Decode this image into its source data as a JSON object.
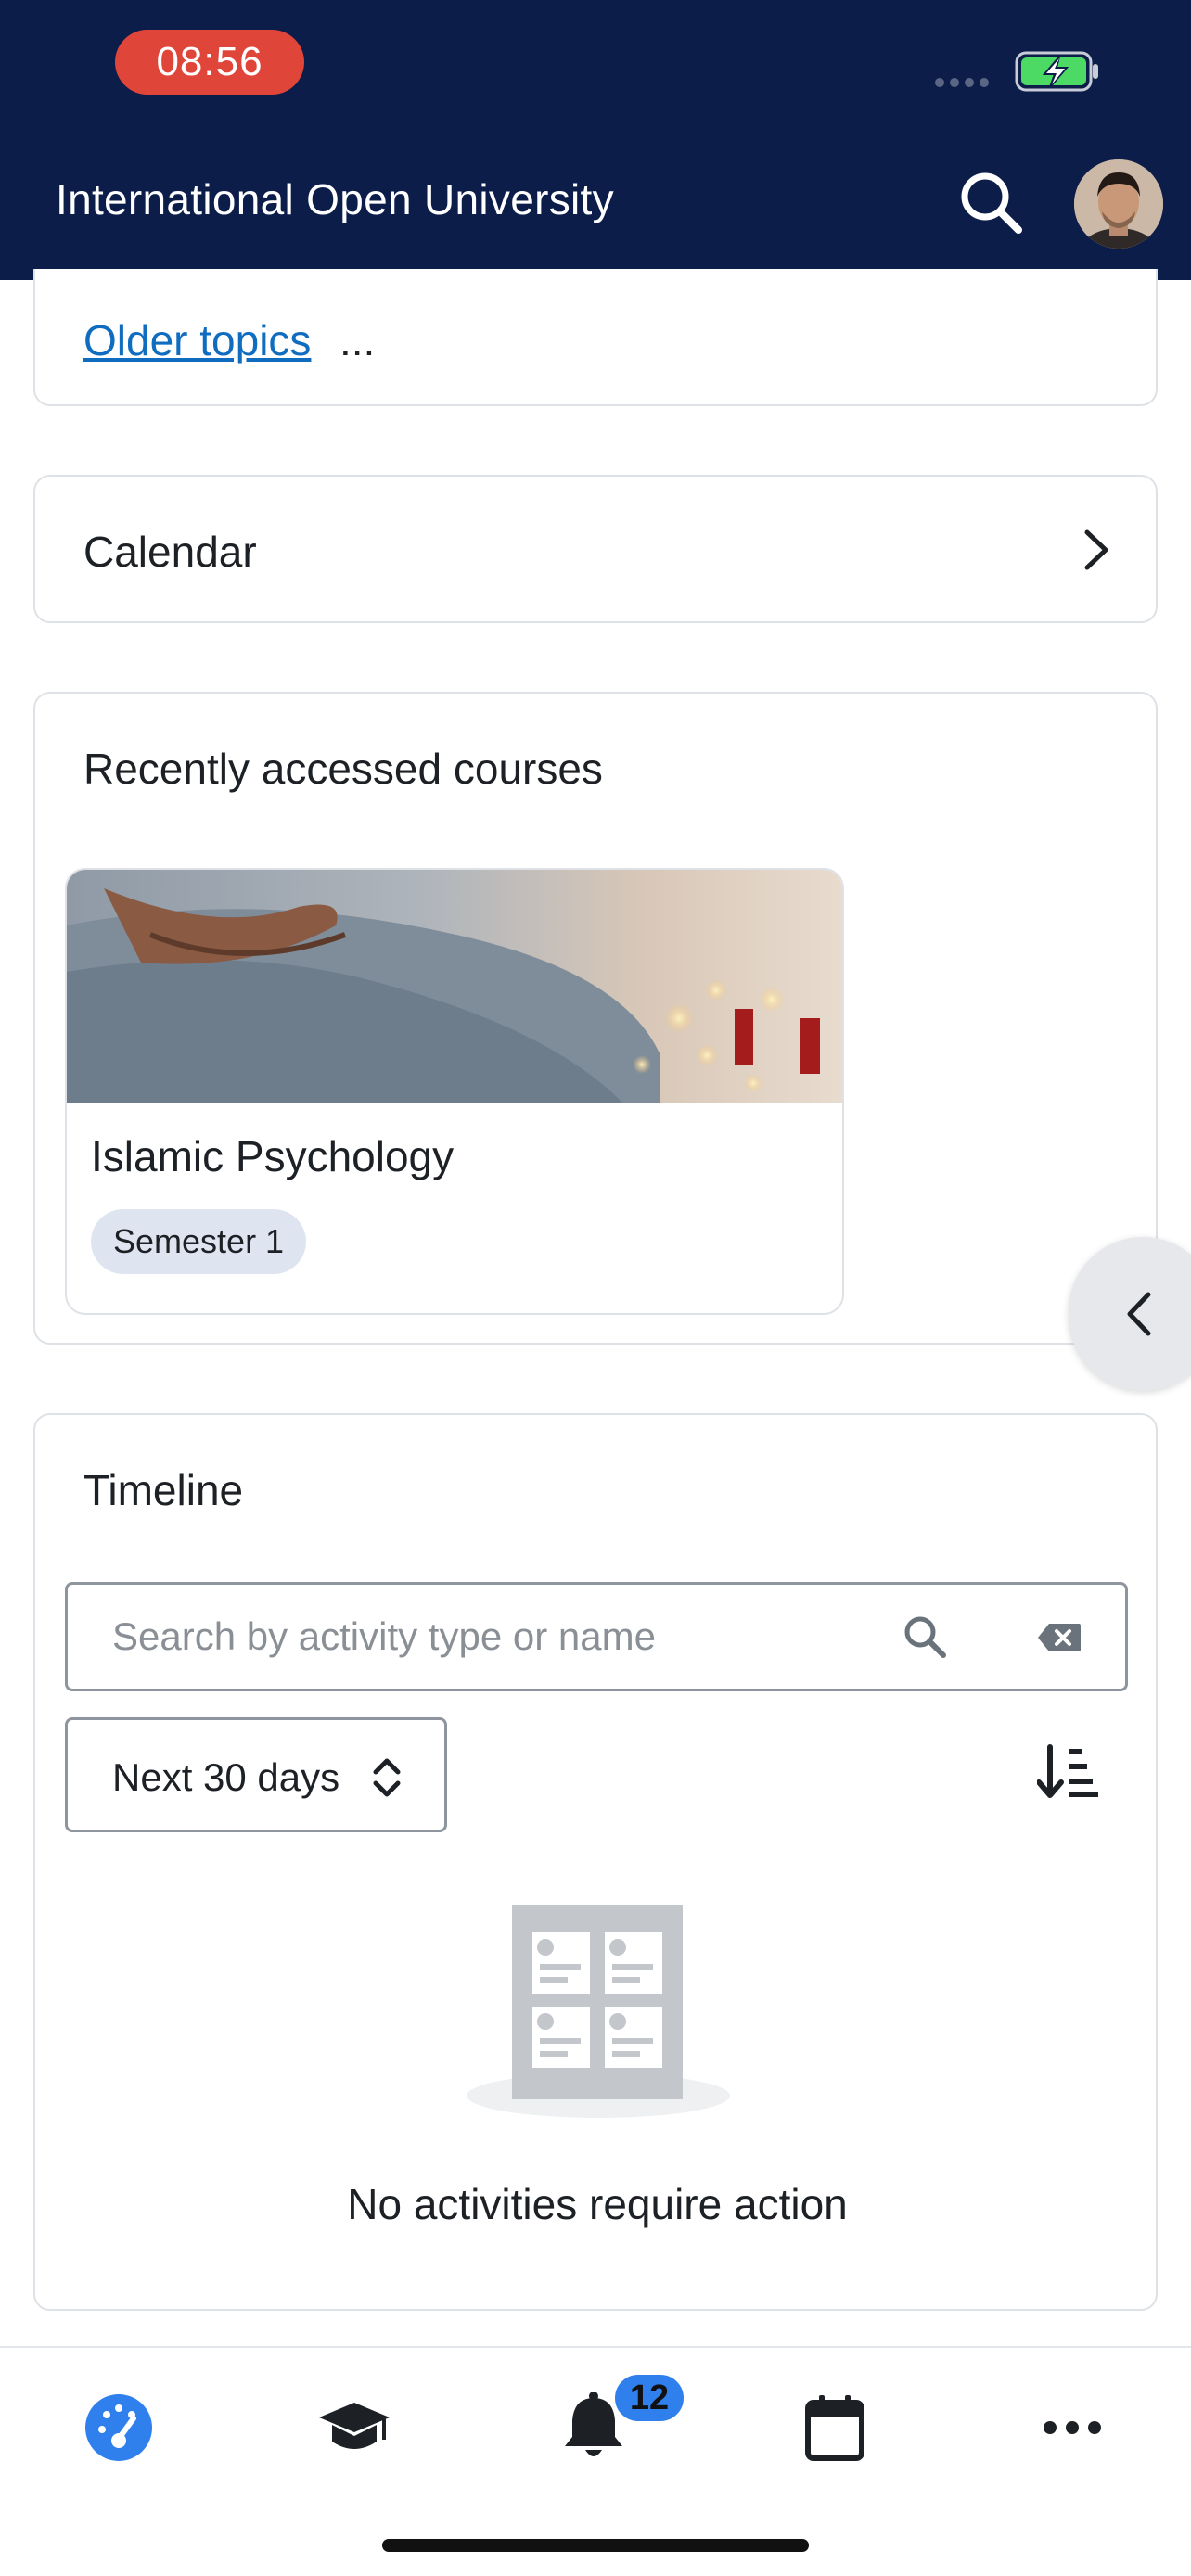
{
  "status_bar": {
    "time": "08:56"
  },
  "header": {
    "title": "International Open University"
  },
  "older_topics": {
    "link_label": "Older topics",
    "suffix": "..."
  },
  "calendar": {
    "title": "Calendar"
  },
  "recent_courses": {
    "title": "Recently accessed courses",
    "courses": [
      {
        "name": "Islamic Psychology",
        "badge": "Semester 1"
      }
    ]
  },
  "timeline": {
    "title": "Timeline",
    "search_placeholder": "Search by activity type or name",
    "search_value": "",
    "filter_value": "Next 30 days",
    "empty_message": "No activities require action"
  },
  "tabbar": {
    "items": [
      {
        "icon": "dashboard-icon",
        "active": true
      },
      {
        "icon": "courses-icon",
        "active": false
      },
      {
        "icon": "notifications-icon",
        "active": false,
        "badge": "12"
      },
      {
        "icon": "calendar-icon",
        "active": false
      },
      {
        "icon": "more-icon",
        "active": false
      }
    ]
  },
  "colors": {
    "header_bg": "#0c1d4a",
    "time_pill": "#e0453a",
    "link": "#0f6cbf",
    "accent": "#2f80ed"
  }
}
